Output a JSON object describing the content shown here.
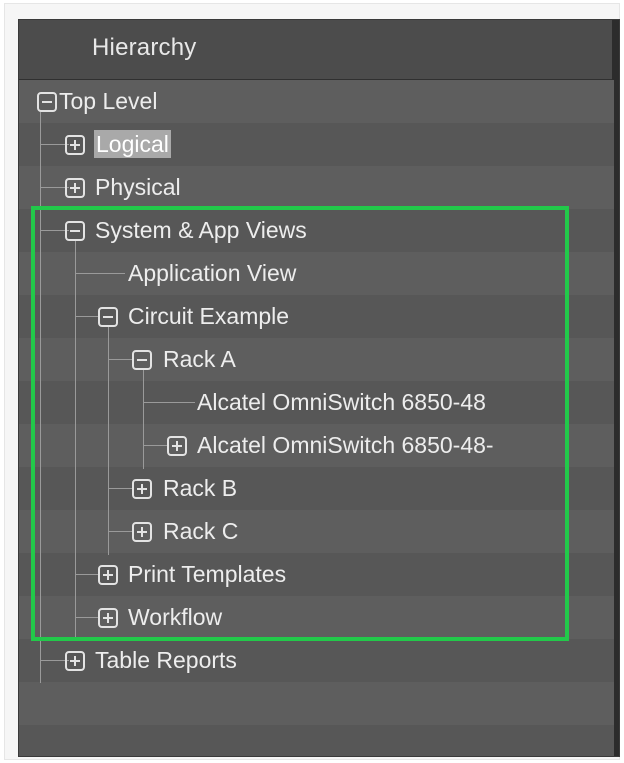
{
  "panel": {
    "title": "Hierarchy"
  },
  "tree": {
    "top_level": "Top Level",
    "logical": "Logical",
    "physical": "Physical",
    "system_app_views": "System & App Views",
    "application_view": "Application View",
    "circuit_example": "Circuit Example",
    "rack_a": "Rack A",
    "switch_1": "Alcatel OmniSwitch 6850-48",
    "switch_2": "Alcatel OmniSwitch 6850-48-",
    "rack_b": "Rack B",
    "rack_c": "Rack C",
    "print_templates": "Print Templates",
    "workflow": "Workflow",
    "table_reports": "Table Reports"
  },
  "colors": {
    "panel_bg": "#5c5c5c",
    "header_bg": "#4c4c4c",
    "selection_bg": "#a9a9a9",
    "highlight_border": "#22c94a"
  }
}
